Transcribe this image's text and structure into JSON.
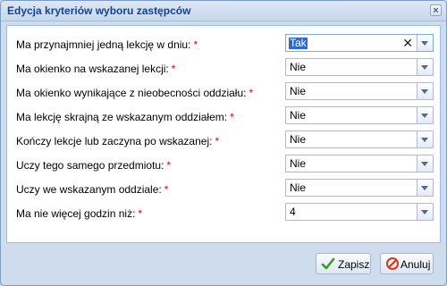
{
  "window": {
    "title": "Edycja kryteriów wyboru zastępców",
    "close_glyph": "×"
  },
  "form": {
    "required_mark": "*",
    "fields": [
      {
        "label": "Ma przynajmniej jedną lekcję w dniu:",
        "value": "Tak",
        "clearable": true,
        "focused": true
      },
      {
        "label": "Ma okienko na wskazanej lekcji:",
        "value": "Nie"
      },
      {
        "label": "Ma okienko wynikające z nieobecności oddziału:",
        "value": "Nie"
      },
      {
        "label": "Ma lekcję skrajną ze wskazanym oddziałem:",
        "value": "Nie"
      },
      {
        "label": "Kończy lekcje lub zaczyna po wskazanej:",
        "value": "Nie"
      },
      {
        "label": "Uczy tego samego przedmiotu:",
        "value": "Nie"
      },
      {
        "label": "Uczy we wskazanym oddziale:",
        "value": "Nie"
      },
      {
        "label": "Ma nie więcej godzin niż:",
        "value": "4"
      }
    ],
    "clear_glyph": "✕"
  },
  "footer": {
    "save_label": "Zapisz",
    "cancel_label": "Anuluj",
    "save_icon": "green-check-icon",
    "cancel_icon": "red-cancel-icon"
  },
  "colors": {
    "title_text": "#15428b",
    "required": "#e00000",
    "selection": "#3169c6"
  }
}
